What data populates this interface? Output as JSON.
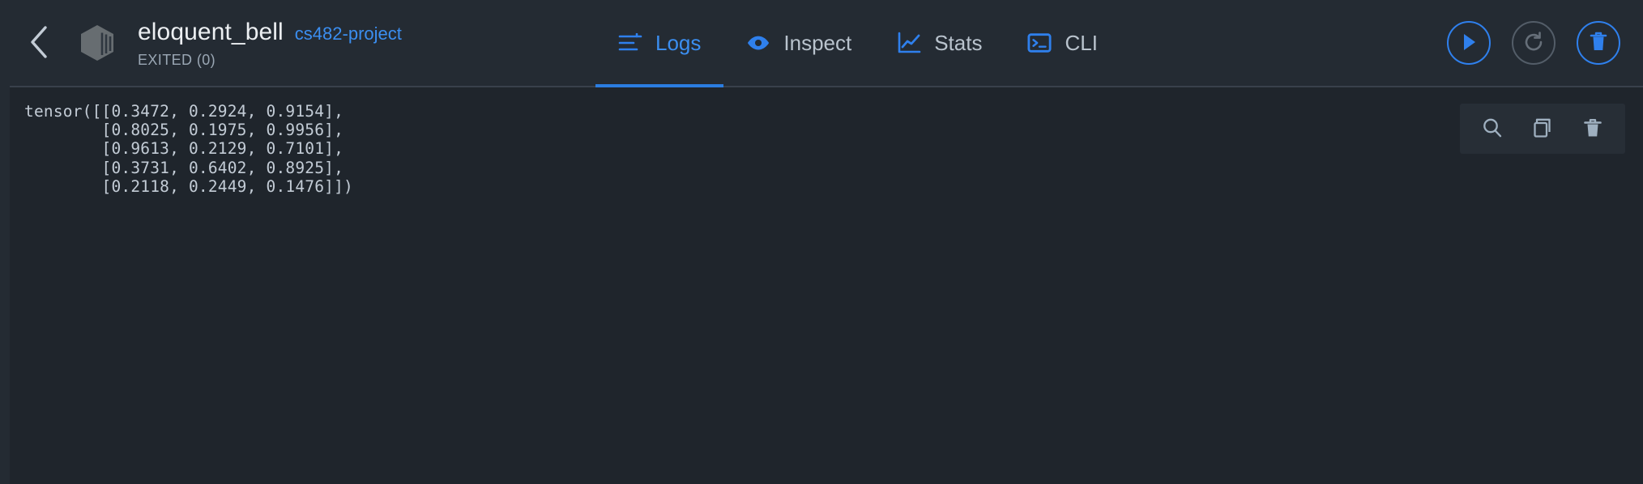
{
  "header": {
    "back_button": "Back",
    "container_icon": "container-cube-icon",
    "container_name": "eloquent_bell",
    "project_tag": "cs482-project",
    "status": "EXITED (0)"
  },
  "tabs": [
    {
      "label": "Logs",
      "icon": "logs-lines-icon",
      "active": true
    },
    {
      "label": "Inspect",
      "icon": "eye-icon",
      "active": false
    },
    {
      "label": "Stats",
      "icon": "line-chart-icon",
      "active": false
    },
    {
      "label": "CLI",
      "icon": "terminal-icon",
      "active": false
    }
  ],
  "actions": [
    {
      "name": "start-button",
      "icon": "play-icon",
      "enabled": true
    },
    {
      "name": "restart-button",
      "icon": "restart-icon",
      "enabled": false
    },
    {
      "name": "delete-button",
      "icon": "trash-icon",
      "enabled": true
    }
  ],
  "log_toolbar": [
    {
      "name": "search-logs-button",
      "icon": "search-icon"
    },
    {
      "name": "copy-logs-button",
      "icon": "copy-icon"
    },
    {
      "name": "clear-logs-button",
      "icon": "trash-icon"
    }
  ],
  "log": {
    "text": "tensor([[0.3472, 0.2924, 0.9154],\n        [0.8025, 0.1975, 0.9956],\n        [0.9613, 0.2129, 0.7101],\n        [0.3731, 0.6402, 0.8925],\n        [0.2118, 0.2449, 0.1476]])",
    "lines": [
      "tensor([[0.3472, 0.2924, 0.9154],",
      "        [0.8025, 0.1975, 0.9956],",
      "        [0.9613, 0.2129, 0.7101],",
      "        [0.3731, 0.6402, 0.8925],",
      "        [0.2118, 0.2449, 0.1476]])"
    ]
  },
  "colors": {
    "accent_blue": "#3b8ef0",
    "underline_blue": "#2b7de0",
    "header_bg": "#242b33",
    "log_bg": "#1f252c",
    "toolbar_bg": "#272e36",
    "text_primary": "#eceff2",
    "text_muted": "#9aa7b4",
    "log_text": "#c3ccd6",
    "disabled_gray": "#535d68"
  }
}
